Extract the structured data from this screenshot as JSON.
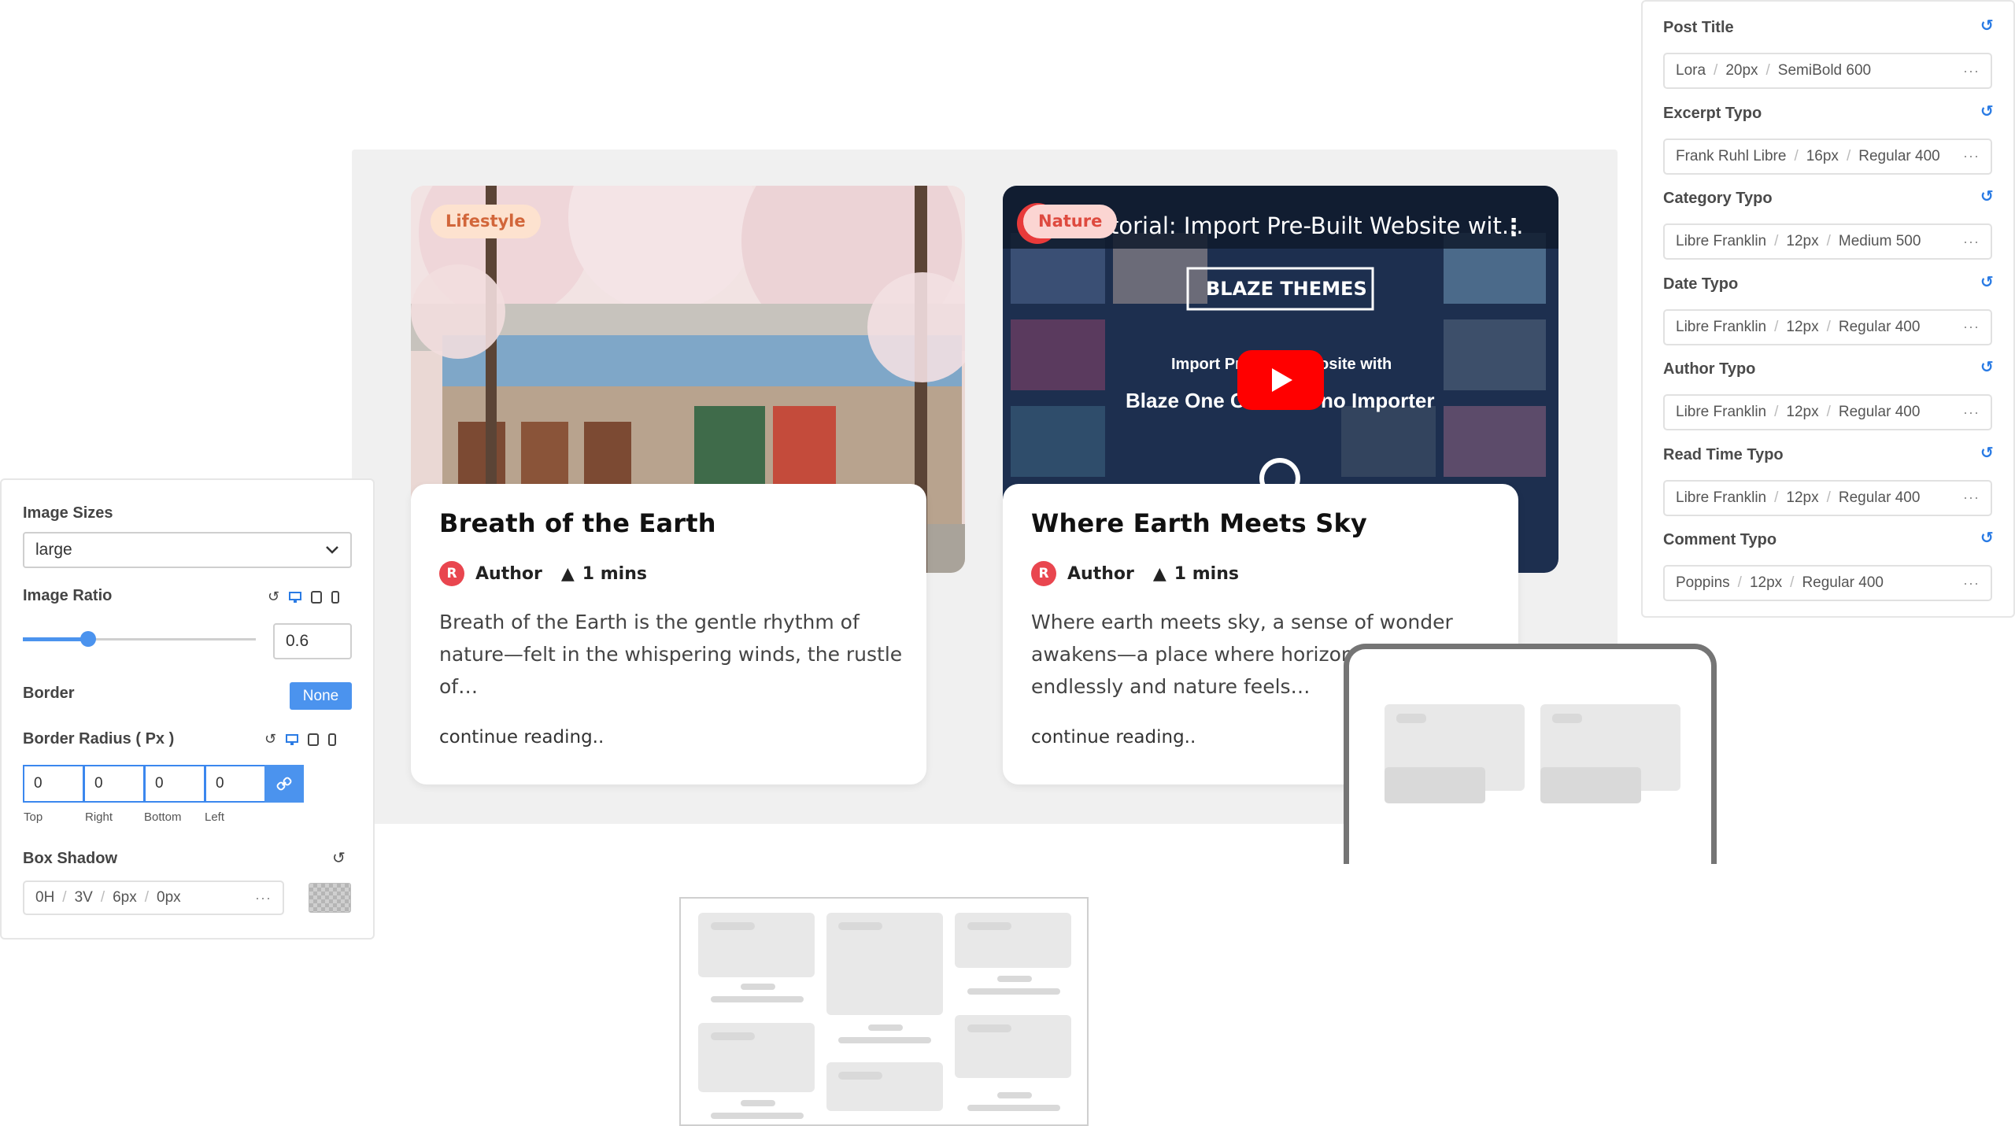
{
  "cards": [
    {
      "badge": "Lifestyle",
      "title": "Breath of the Earth",
      "author": "Author",
      "author_initial": "R",
      "read_time": "1 mins",
      "excerpt": [
        "Breath of the Earth is the gentle rhythm of",
        "nature—felt in the whispering winds, the rustle",
        "of…"
      ],
      "more": "continue reading.."
    },
    {
      "badge": "Nature",
      "title": "Where Earth Meets Sky",
      "author": "Author",
      "author_initial": "R",
      "read_time": "1 mins",
      "excerpt": [
        "Where earth meets sky, a sense of wonder",
        "awakens—a place where horizon",
        "endlessly and nature feels…"
      ],
      "more": "continue reading..",
      "video": {
        "title": "torial: Import Pre-Built Website wit...",
        "brand": "BLAZE THEMES",
        "line1": [
          "Import Pr",
          "osite with"
        ],
        "line2": [
          "Blaze One C",
          "no Importer"
        ]
      }
    }
  ],
  "typography": [
    {
      "label": "Post Title",
      "font": "Lora",
      "size": "20px",
      "weight": "SemiBold 600"
    },
    {
      "label": "Excerpt Typo",
      "font": "Frank Ruhl Libre",
      "size": "16px",
      "weight": "Regular 400"
    },
    {
      "label": "Category Typo",
      "font": "Libre Franklin",
      "size": "12px",
      "weight": "Medium 500"
    },
    {
      "label": "Date Typo",
      "font": "Libre Franklin",
      "size": "12px",
      "weight": "Regular 400"
    },
    {
      "label": "Author Typo",
      "font": "Libre Franklin",
      "size": "12px",
      "weight": "Regular 400"
    },
    {
      "label": "Read Time Typo",
      "font": "Libre Franklin",
      "size": "12px",
      "weight": "Regular 400"
    },
    {
      "label": "Comment Typo",
      "font": "Poppins",
      "size": "12px",
      "weight": "Regular 400"
    }
  ],
  "settings": {
    "image_sizes_label": "Image Sizes",
    "image_sizes_value": "large",
    "image_ratio_label": "Image Ratio",
    "image_ratio_value": "0.6",
    "image_ratio_slider_fraction": 0.28,
    "border_label": "Border",
    "border_value": "None",
    "border_radius_label": "Border Radius ( Px )",
    "radius": [
      {
        "value": "0",
        "caption": "Top"
      },
      {
        "value": "0",
        "caption": "Right"
      },
      {
        "value": "0",
        "caption": "Bottom"
      },
      {
        "value": "0",
        "caption": "Left"
      }
    ],
    "box_shadow_label": "Box Shadow",
    "box_shadow": [
      "0H",
      "3V",
      "6px",
      "0px"
    ]
  },
  "colors": {
    "accent": "#4b93ee",
    "reset_icon": "#2a7be4",
    "avatar": "#e9464f",
    "youtube_red": "#ff0000"
  }
}
